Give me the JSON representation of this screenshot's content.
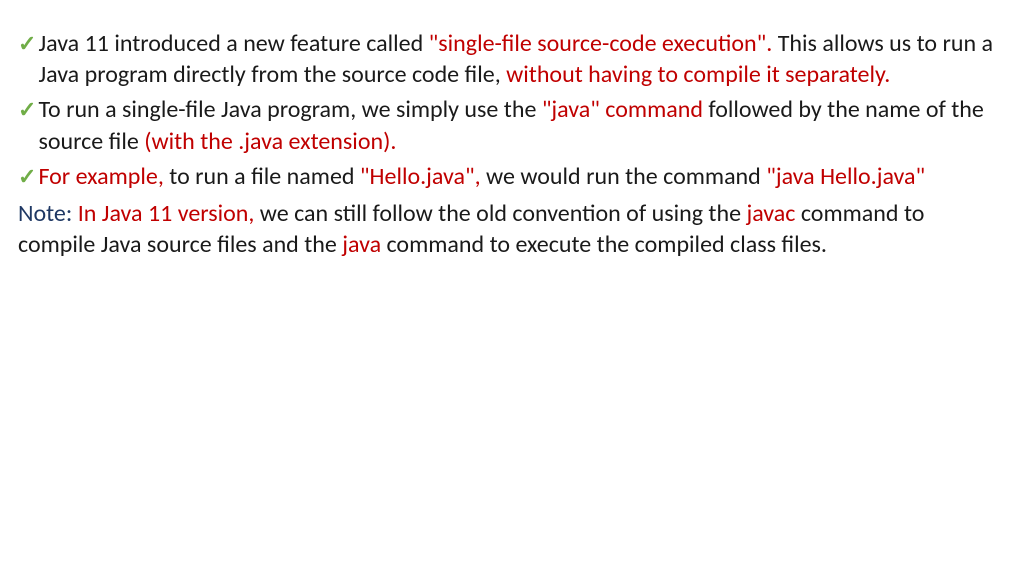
{
  "colors": {
    "checkmark": "#70ad47",
    "red": "#c00000",
    "black": "#1a1a1a",
    "navy": "#1f3864"
  },
  "bullets": [
    {
      "parts": [
        {
          "text": "Java 11 introduced a new feature called ",
          "color": "black"
        },
        {
          "text": "\"single-file source-code execution\". ",
          "color": "red"
        },
        {
          "text": "This allows us to run a Java program directly from the source code file, ",
          "color": "black"
        },
        {
          "text": "without having to compile it separately.",
          "color": "red"
        }
      ]
    },
    {
      "parts": [
        {
          "text": "To run a single-file Java program, we simply use the ",
          "color": "black"
        },
        {
          "text": "\"java\" command ",
          "color": "red"
        },
        {
          "text": "followed by the name of the source file ",
          "color": "black"
        },
        {
          "text": "(with the .java extension).",
          "color": "red"
        }
      ]
    },
    {
      "parts": [
        {
          "text": "For example, ",
          "color": "red"
        },
        {
          "text": "to run a file named ",
          "color": "black"
        },
        {
          "text": "\"Hello.java\", ",
          "color": "red"
        },
        {
          "text": "we would run the command ",
          "color": "black"
        },
        {
          "text": "\"java Hello.java\"",
          "color": "red"
        }
      ]
    }
  ],
  "note": {
    "label": "Note: ",
    "parts": [
      {
        "text": "In Java 11 version, ",
        "color": "red"
      },
      {
        "text": "we can still follow the old convention of using the ",
        "color": "black"
      },
      {
        "text": "javac ",
        "color": "red"
      },
      {
        "text": "command to compile Java source files and the ",
        "color": "black"
      },
      {
        "text": "java ",
        "color": "red"
      },
      {
        "text": "command to execute the compiled class files.",
        "color": "black"
      }
    ]
  }
}
